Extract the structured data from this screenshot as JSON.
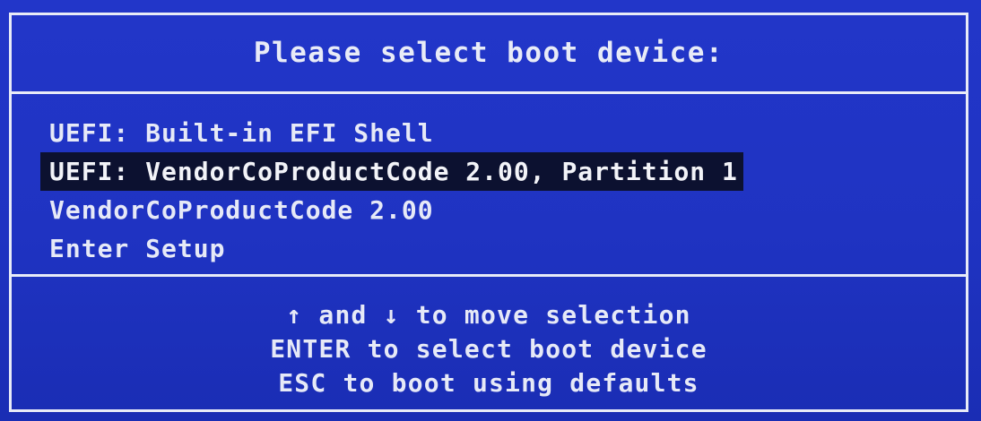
{
  "title": "Please select boot device:",
  "boot_devices": [
    {
      "label": "UEFI: Built-in EFI Shell",
      "selected": false
    },
    {
      "label": "UEFI: VendorCoProductCode 2.00, Partition 1",
      "selected": true
    },
    {
      "label": "VendorCoProductCode 2.00",
      "selected": false
    },
    {
      "label": "Enter Setup",
      "selected": false
    }
  ],
  "help": {
    "move_up_arrow": "↑",
    "move_and": " and ",
    "move_down_arrow": "↓",
    "move_suffix": " to move selection",
    "enter_line": "ENTER to select boot device",
    "esc_line": "ESC to boot using defaults"
  },
  "colors": {
    "background": "#1f33c2",
    "text": "#e6e9f7",
    "selection_bg": "#0c1130"
  }
}
